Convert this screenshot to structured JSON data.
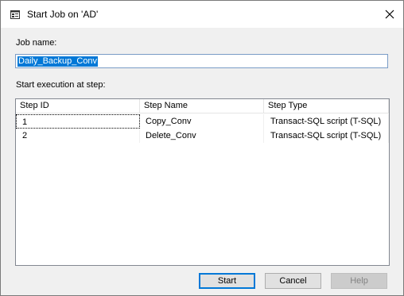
{
  "window": {
    "title": "Start Job on 'AD'"
  },
  "form": {
    "job_name_label": "Job name:",
    "job_name_value": "Daily_Backup_Conv",
    "step_label": "Start execution at step:"
  },
  "steps_table": {
    "columns": [
      "Step ID",
      "Step Name",
      "Step Type"
    ],
    "rows": [
      [
        "1",
        "Copy_Conv",
        "Transact-SQL script (T-SQL)"
      ],
      [
        "2",
        "Delete_Conv",
        "Transact-SQL script (T-SQL)"
      ]
    ]
  },
  "buttons": {
    "start": "Start",
    "cancel": "Cancel",
    "help": "Help"
  },
  "icons": {
    "title": "job-window-icon",
    "close": "close-icon"
  },
  "colors": {
    "selection": "#0078d7",
    "default_button_border": "#0078d7"
  }
}
